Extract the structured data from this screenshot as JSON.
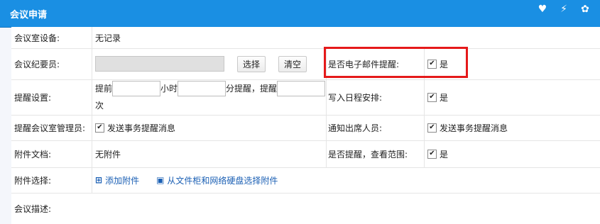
{
  "dialog": {
    "title": "会议申请",
    "icons": [
      "heart-icon",
      "lightning-icon",
      "settings-icon"
    ]
  },
  "rows": {
    "equipment": {
      "label": "会议室设备:",
      "value": "无记录"
    },
    "recorder": {
      "label": "会议纪要员:",
      "select_label": "选择",
      "clear_label": "清空"
    },
    "email": {
      "label": "是否电子邮件提醒:",
      "option": "是"
    },
    "reminder": {
      "label": "提醒设置:",
      "prefix": "提前",
      "hours": "小时",
      "minutes": "分提醒，提醒",
      "times": "次"
    },
    "schedule": {
      "label": "写入日程安排:",
      "option": "是"
    },
    "notify_admin": {
      "label": "提醒会议室管理员:",
      "option": "发送事务提醒消息"
    },
    "notify_attendees": {
      "label": "通知出席人员:",
      "option": "发送事务提醒消息"
    },
    "attachments": {
      "label": "附件文档:",
      "value": "无附件"
    },
    "remind_view": {
      "label": "是否提醒，查看范围:",
      "option": "是"
    },
    "attach_select": {
      "label": "附件选择:",
      "add": "添加附件",
      "from_cabinet": "从文件柜和网络硬盘选择附件"
    },
    "description": {
      "label": "会议描述:"
    }
  }
}
